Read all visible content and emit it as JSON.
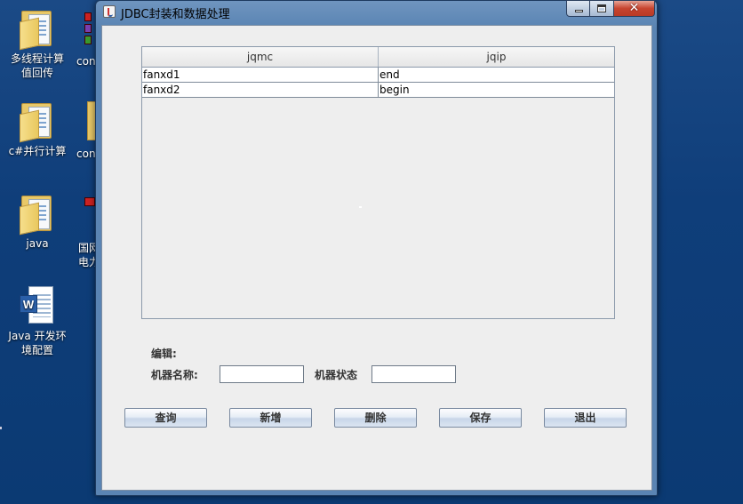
{
  "desktop": {
    "icons": [
      {
        "label_line1": "多线程计算",
        "label_line2": "值回传",
        "type": "folder"
      },
      {
        "label_line1": "c#并行计算",
        "label_line2": "",
        "type": "folder"
      },
      {
        "label_line1": "java",
        "label_line2": "",
        "type": "folder"
      },
      {
        "label_line1": "Java 开发环",
        "label_line2": "境配置",
        "type": "word"
      }
    ],
    "partial_icons": [
      {
        "label": "con"
      },
      {
        "label": "con"
      },
      {
        "label_line1": "国网",
        "label_line2": "电力"
      }
    ]
  },
  "window": {
    "title": "JDBC封装和数据处理",
    "controls": {
      "close_glyph": "✕"
    },
    "table": {
      "columns": [
        "jqmc",
        "jqip"
      ],
      "rows": [
        [
          "fanxd1",
          "end"
        ],
        [
          "fanxd2",
          "begin"
        ]
      ]
    },
    "form": {
      "edit_label": "编辑:",
      "name_label": "机器名称:",
      "name_value": "",
      "status_label": "机器状态",
      "status_value": ""
    },
    "buttons": {
      "query": "查询",
      "add": "新增",
      "delete": "删除",
      "save": "保存",
      "exit": "退出"
    }
  }
}
